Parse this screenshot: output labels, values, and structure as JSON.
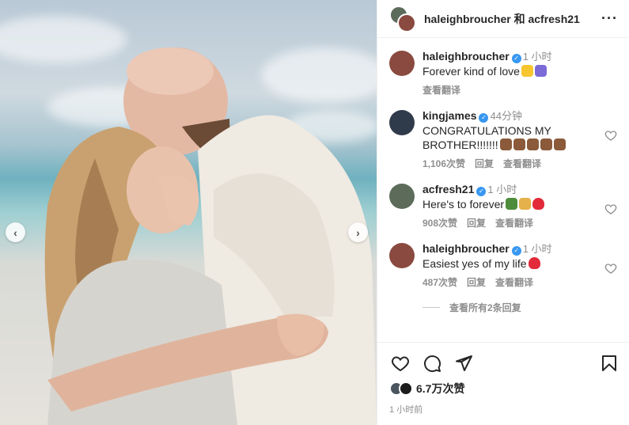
{
  "header": {
    "title": "haleighbroucher 和 acfresh21",
    "more_icon": "more-horizontal-icon"
  },
  "photo": {
    "prev_label": "‹",
    "next_label": "›"
  },
  "comments": [
    {
      "user": "haleighbroucher",
      "verified": true,
      "time": "1 小时",
      "text": "Forever kind of love",
      "emojis": [
        "yellow-heart",
        "infinity"
      ],
      "meta": [
        "查看翻译"
      ],
      "avatar_color": "#8a4a3f",
      "has_heart": false
    },
    {
      "user": "kingjames",
      "verified": true,
      "time": "44分钟",
      "text": "CONGRATULATIONS MY BROTHER!!!!!!!",
      "emojis": [
        "raised-hands",
        "raised-hands",
        "raised-hands",
        "raised-hands",
        "raised-hands"
      ],
      "meta": [
        "1,106次赞",
        "回复",
        "查看翻译"
      ],
      "avatar_color": "#2f3a4a",
      "has_heart": true
    },
    {
      "user": "acfresh21",
      "verified": true,
      "time": "1 小时",
      "text": "Here's to forever",
      "emojis": [
        "champagne",
        "clinking-glasses",
        "red-heart"
      ],
      "meta": [
        "908次赞",
        "回复",
        "查看翻译"
      ],
      "avatar_color": "#5c6b5a",
      "has_heart": true
    },
    {
      "user": "haleighbroucher",
      "verified": true,
      "time": "1 小时",
      "text": "Easiest yes of my life",
      "emojis": [
        "red-heart"
      ],
      "meta": [
        "487次赞",
        "回复",
        "查看翻译"
      ],
      "avatar_color": "#8a4a3f",
      "has_heart": true
    }
  ],
  "view_replies": "查看所有2条回复",
  "likes": "6.7万次赞",
  "time_ago": "1 小时前",
  "colors": {
    "verified": "#3897f0",
    "secondary_text": "#8e8e8e",
    "heart_red": "#ed4956"
  }
}
